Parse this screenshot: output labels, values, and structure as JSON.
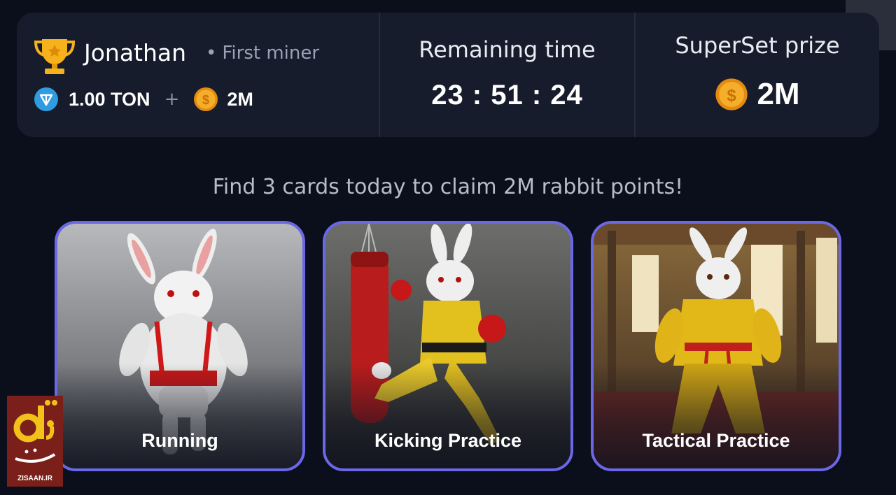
{
  "user": {
    "name": "Jonathan",
    "rank": "First miner",
    "reward_ton": "1.00 TON",
    "plus": "+",
    "reward_coins": "2M"
  },
  "timer": {
    "heading": "Remaining time",
    "value": "23 : 51 : 24"
  },
  "prize": {
    "heading": "SuperSet prize",
    "value": "2M"
  },
  "instruction": "Find 3 cards today to claim 2M rabbit points!",
  "cards": [
    {
      "title": "Running"
    },
    {
      "title": "Kicking Practice"
    },
    {
      "title": "Tactical Practice"
    }
  ],
  "watermark": {
    "fa": "زی‌سان",
    "en": "ZISAAN.IR"
  },
  "colors": {
    "background": "#0b0f1c",
    "panel": "#161c2b",
    "card_border": "#6a68e6",
    "coin": "#f2a623",
    "ton": "#2f9be0"
  }
}
